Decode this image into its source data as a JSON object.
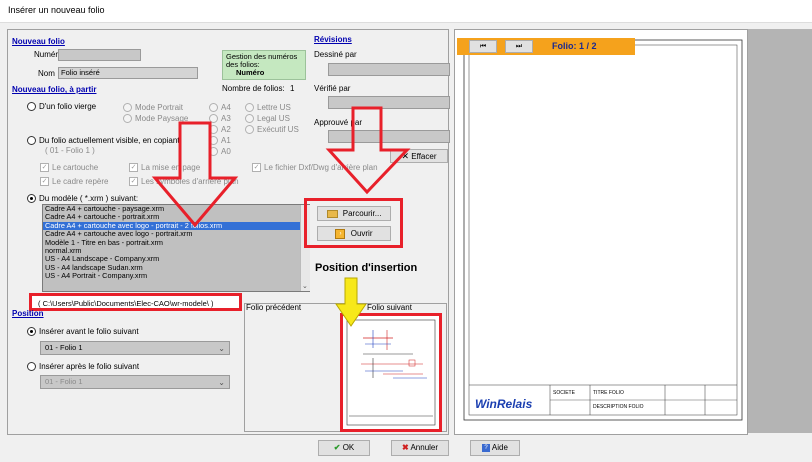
{
  "window": {
    "title": "Insérer un nouveau folio"
  },
  "nouveau_folio": {
    "section_title": "Nouveau folio",
    "numero_label": "Numéro",
    "numero_value": "",
    "nom_label": "Nom",
    "nom_value": "Folio inséré",
    "gestion_text": "Gestion des numéros des folios:",
    "gestion_value": "Numéro",
    "nombre_label": "Nombre de folios:",
    "nombre_value": "1"
  },
  "revisions": {
    "section_title": "Révisions",
    "dessine_label": "Dessiné par",
    "verifie_label": "Vérifié par",
    "approuve_label": "Approuvé par",
    "effacer_label": "Effacer"
  },
  "a_partir": {
    "section_title": "Nouveau folio, à partir",
    "vierge_label": "D'un folio vierge",
    "mode_portrait": "Mode Portrait",
    "mode_paysage": "Mode Paysage",
    "formats": [
      "A4",
      "A3",
      "A2",
      "A1",
      "A0"
    ],
    "formats_us": [
      "Lettre US",
      "Legal US",
      "Exécutif US"
    ],
    "visible_label": "Du folio actuellement visible, en copiant:",
    "visible_value": "( 01 - Folio 1 )",
    "chk_cartouche": "Le cartouche",
    "chk_mise_en_page": "La mise en page",
    "chk_fichier_dxf": "Le fichier Dxf/Dwg d'arrière plan",
    "chk_cadre": "Le cadre repère",
    "chk_symboles": "Les symboles d'arrière plan",
    "modele_label": "Du modèle ( *.xrm ) suivant:",
    "templates": [
      "Cadre A4 + cartouche - paysage.xrm",
      "Cadre A4 + cartouche - portrait.xrm",
      "Cadre A4 + cartouche avec logo - portrait - 2 folios.xrm",
      "Cadre A4 + cartouche avec logo - portrait.xrm",
      "Modèle 1 - Titre en bas - portrait.xrm",
      "normal.xrm",
      "US - A4 Landscape - Company.xrm",
      "US - A4 landscape Sudan.xrm",
      "US - A4 Portrait - Company.xrm"
    ],
    "selected_template_index": 2,
    "path": "( C:\\Users\\Public\\Documents\\Elec-CAO\\wr-modele\\ )",
    "parcourir_label": "Parcourir...",
    "ouvrir_label": "Ouvrir"
  },
  "position": {
    "section_title": "Position",
    "avant_label": "Insérer avant le folio suivant",
    "avant_value": "01 - Folio 1",
    "apres_label": "Insérer après le folio suivant",
    "apres_value": "01 - Folio 1",
    "precedent_label": "Folio précédent",
    "suivant_label": "Folio suivant",
    "insertion_label": "Position d'insertion"
  },
  "preview": {
    "nav_first": "⏮",
    "nav_next": "⏭",
    "folio_label": "Folio: 1 / 2",
    "brand": "WinRelais",
    "societe": "SOCIETE",
    "titre_folio": "TITRE FOLIO",
    "description_folio": "DESCRIPTION FOLIO"
  },
  "footer": {
    "ok_label": "OK",
    "annuler_label": "Annuler",
    "aide_label": "Aide"
  },
  "colors": {
    "accent_orange": "#f5a21c",
    "red_annotation": "#e8202a",
    "yellow_arrow": "#f7e81a",
    "section_blue": "#0000b0",
    "selection_blue": "#3370d6",
    "gestion_green": "#c5e8c0",
    "winrelais_blue": "#1a3eb0"
  }
}
